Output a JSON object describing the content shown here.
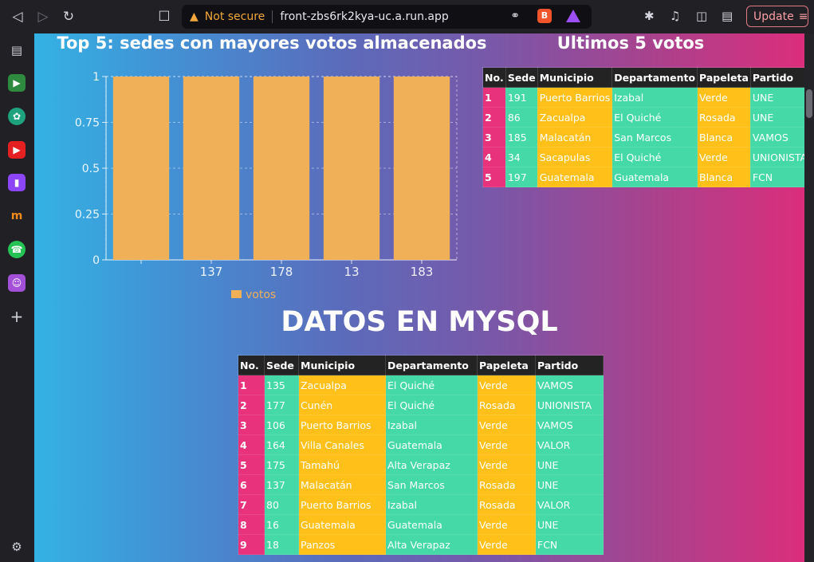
{
  "browser": {
    "security_label": "Not secure",
    "url": "front-zbs6rk2kya-uc.a.run.app",
    "update_label": "Update"
  },
  "chart": {
    "title": "Top 5: sedes con mayores votos almacenados",
    "legend_label": "votos",
    "bar_color": "#f0b058"
  },
  "chart_data": {
    "type": "bar",
    "title": "Top 5: sedes con mayores votos almacenados",
    "categories": [
      "",
      "137",
      "178",
      "13",
      "183"
    ],
    "series": [
      {
        "name": "votos",
        "values": [
          1,
          1,
          1,
          1,
          1
        ]
      }
    ],
    "ylim": [
      0,
      1
    ],
    "yticks": [
      "0",
      "0.25",
      "0.5",
      "0.75",
      "1"
    ],
    "grid": true,
    "legend": "bottom"
  },
  "last5": {
    "title": "Ultimos 5 votos",
    "headers": [
      "No.",
      "Sede",
      "Municipio",
      "Departamento",
      "Papeleta",
      "Partido"
    ],
    "rows": [
      [
        "1",
        "191",
        "Puerto Barrios",
        "Izabal",
        "Verde",
        "UNE"
      ],
      [
        "2",
        "86",
        "Zacualpa",
        "El Quiché",
        "Rosada",
        "UNE"
      ],
      [
        "3",
        "185",
        "Malacatán",
        "San Marcos",
        "Blanca",
        "VAMOS"
      ],
      [
        "4",
        "34",
        "Sacapulas",
        "El Quiché",
        "Verde",
        "UNIONISTA"
      ],
      [
        "5",
        "197",
        "Guatemala",
        "Guatemala",
        "Blanca",
        "FCN"
      ]
    ]
  },
  "mysql": {
    "title": "DATOS EN MYSQL",
    "headers": [
      "No.",
      "Sede",
      "Municipio",
      "Departamento",
      "Papeleta",
      "Partido"
    ],
    "rows": [
      [
        "1",
        "135",
        "Zacualpa",
        "El Quiché",
        "Verde",
        "VAMOS"
      ],
      [
        "2",
        "177",
        "Cunén",
        "El Quiché",
        "Rosada",
        "UNIONISTA"
      ],
      [
        "3",
        "106",
        "Puerto Barrios",
        "Izabal",
        "Verde",
        "VAMOS"
      ],
      [
        "4",
        "164",
        "Villa Canales",
        "Guatemala",
        "Verde",
        "VALOR"
      ],
      [
        "5",
        "175",
        "Tamahú",
        "Alta Verapaz",
        "Verde",
        "UNE"
      ],
      [
        "6",
        "137",
        "Malacatán",
        "San Marcos",
        "Rosada",
        "UNE"
      ],
      [
        "7",
        "80",
        "Puerto Barrios",
        "Izabal",
        "Rosada",
        "VALOR"
      ],
      [
        "8",
        "16",
        "Guatemala",
        "Guatemala",
        "Verde",
        "UNE"
      ],
      [
        "9",
        "18",
        "Panzos",
        "Alta Verapaz",
        "Verde",
        "FCN"
      ]
    ]
  }
}
